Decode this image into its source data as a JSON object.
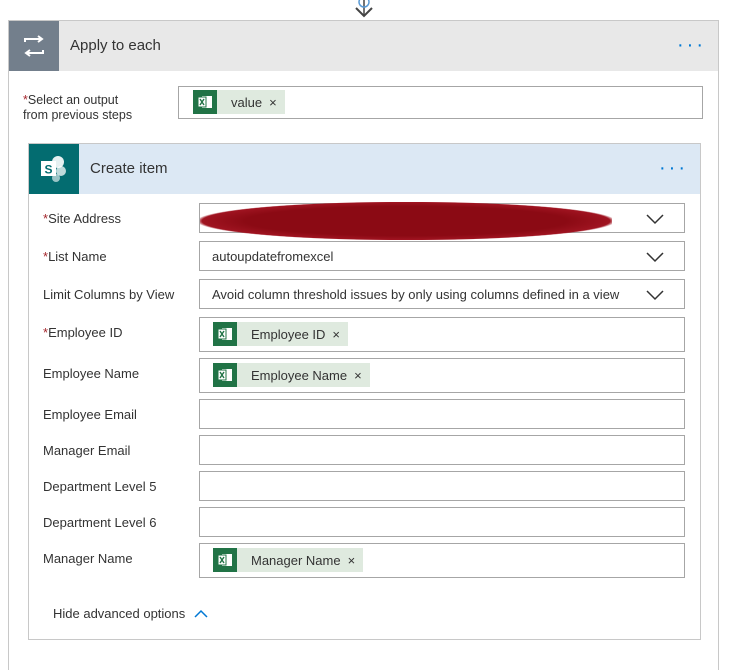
{
  "apply_to_each": {
    "title": "Apply to each",
    "more_icon": "ellipsis-icon",
    "output_label_line1": "Select an output",
    "output_label_line2": "from previous steps",
    "required_mark": "*",
    "token": {
      "label": "value",
      "icon": "excel-icon",
      "remove": "×"
    }
  },
  "create_item": {
    "title": "Create item",
    "icon": "sharepoint-icon",
    "fields": {
      "site_address": {
        "label": "Site Address",
        "required": "*",
        "value_redacted": true
      },
      "list_name": {
        "label": "List Name",
        "required": "*",
        "value": "autoupdatefromexcel"
      },
      "limit_columns": {
        "label": "Limit Columns by View",
        "value": "Avoid column threshold issues by only using columns defined in a view"
      },
      "employee_id": {
        "label": "Employee ID",
        "required": "*",
        "token": "Employee ID",
        "remove": "×"
      },
      "employee_name": {
        "label": "Employee Name",
        "token": "Employee Name",
        "remove": "×"
      },
      "employee_email": {
        "label": "Employee Email",
        "value": ""
      },
      "manager_email": {
        "label": "Manager Email",
        "value": ""
      },
      "department_level_5": {
        "label": "Department Level 5",
        "value": ""
      },
      "department_level_6": {
        "label": "Department Level 6",
        "value": ""
      },
      "manager_name": {
        "label": "Manager Name",
        "token": "Manager Name",
        "remove": "×"
      }
    },
    "advanced_toggle": "Hide advanced options"
  },
  "colors": {
    "accent": "#0078d4",
    "loop_icon_bg": "#737f8c",
    "sharepoint_bg": "#036c70",
    "excel_green": "#217346",
    "token_bg": "#dfeadf",
    "required": "#a4262c",
    "redaction": "#8b0a14"
  }
}
